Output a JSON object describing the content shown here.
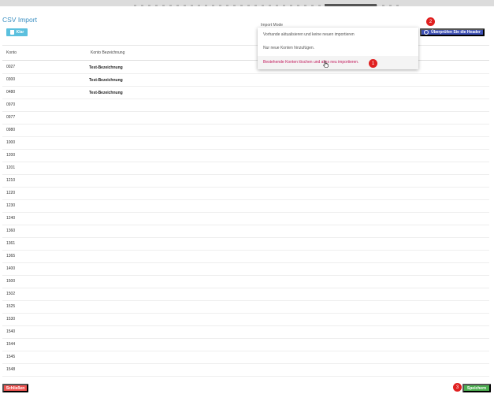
{
  "title": "CSV Import",
  "toolbar": {
    "clear_label": "Klar",
    "clear_icon": "trash-icon",
    "check_headers_label": "Überprüfen Sie die Header",
    "check_icon": "check-circle-icon"
  },
  "import_mode": {
    "label": "Import Mode",
    "options": [
      "Vorhande aktualisieren und keine neuen importieren",
      "Nur neue Konten hinzufügen.",
      "Bestehende Konten löschen und alles neu importieren."
    ],
    "selected": "Bestehende Konten löschen und alles neu importieren."
  },
  "badges": {
    "one": "1",
    "two": "2",
    "three": "3"
  },
  "table": {
    "headers": [
      "Konto",
      "Konto Bezeichnung"
    ],
    "rows": [
      [
        "0027",
        "Test-Bezeichnung"
      ],
      [
        "0300",
        "Test-Bezeichnung"
      ],
      [
        "0480",
        "Test-Bezeichnung"
      ],
      [
        "0970",
        ""
      ],
      [
        "0977",
        ""
      ],
      [
        "0980",
        ""
      ],
      [
        "1000",
        ""
      ],
      [
        "1200",
        ""
      ],
      [
        "1201",
        ""
      ],
      [
        "1210",
        ""
      ],
      [
        "1220",
        ""
      ],
      [
        "1230",
        ""
      ],
      [
        "1240",
        ""
      ],
      [
        "1360",
        ""
      ],
      [
        "1361",
        ""
      ],
      [
        "1365",
        ""
      ],
      [
        "1400",
        ""
      ],
      [
        "1500",
        ""
      ],
      [
        "1502",
        ""
      ],
      [
        "1525",
        ""
      ],
      [
        "1530",
        ""
      ],
      [
        "1540",
        ""
      ],
      [
        "1544",
        ""
      ],
      [
        "1545",
        ""
      ],
      [
        "1548",
        ""
      ]
    ]
  },
  "footer": {
    "close_label": "Schließen",
    "save_label": "Speichern"
  },
  "colors": {
    "title": "#3a8fc2",
    "clear": "#5bc0de",
    "check_headers": "#3f51b5",
    "badge": "#e02020",
    "selected_option": "#c2185b",
    "close": "#ef5350",
    "save": "#4caf50"
  }
}
